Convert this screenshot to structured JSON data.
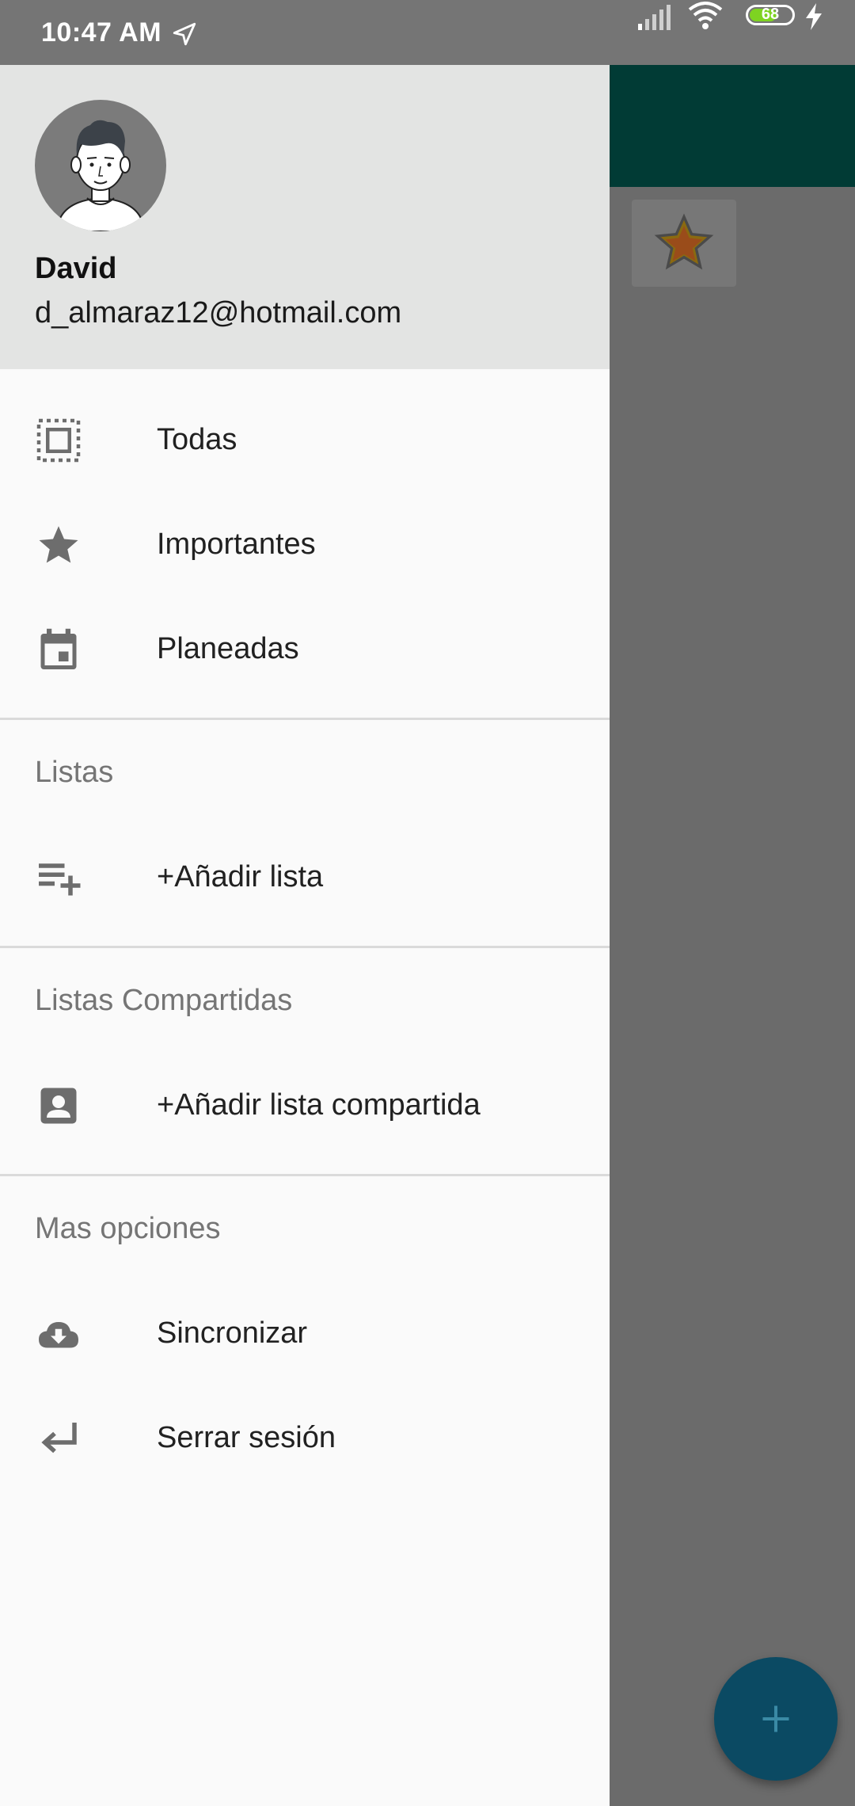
{
  "status_bar": {
    "time": "10:47 AM",
    "battery_level": "68",
    "battery_fraction": 0.68
  },
  "drawer": {
    "header": {
      "name": "David",
      "email": "d_almaraz12@hotmail.com"
    },
    "main_items": [
      {
        "label": "Todas",
        "icon": "all-lists-icon"
      },
      {
        "label": "Importantes",
        "icon": "star-icon"
      },
      {
        "label": "Planeadas",
        "icon": "calendar-icon"
      }
    ],
    "lists_section": {
      "title": "Listas",
      "add_label": "+Añadir lista",
      "icon": "playlist-add-icon"
    },
    "shared_section": {
      "title": "Listas Compartidas",
      "add_label": "+Añadir lista compartida",
      "icon": "contact-card-icon"
    },
    "more_section": {
      "title": "Mas opciones",
      "items": [
        {
          "label": "Sincronizar",
          "icon": "cloud-download-icon"
        },
        {
          "label": "Serrar sesión",
          "icon": "logout-arrow-icon"
        }
      ]
    }
  },
  "background": {
    "appbar_color": "#013b35",
    "fab_icon": "plus-icon",
    "card_icon": "star-icon"
  },
  "colors": {
    "drawer_bg": "#fafafa",
    "header_bg": "#e3e4e3",
    "icon_gray": "#6d6d6d",
    "section_gray": "#757575"
  }
}
